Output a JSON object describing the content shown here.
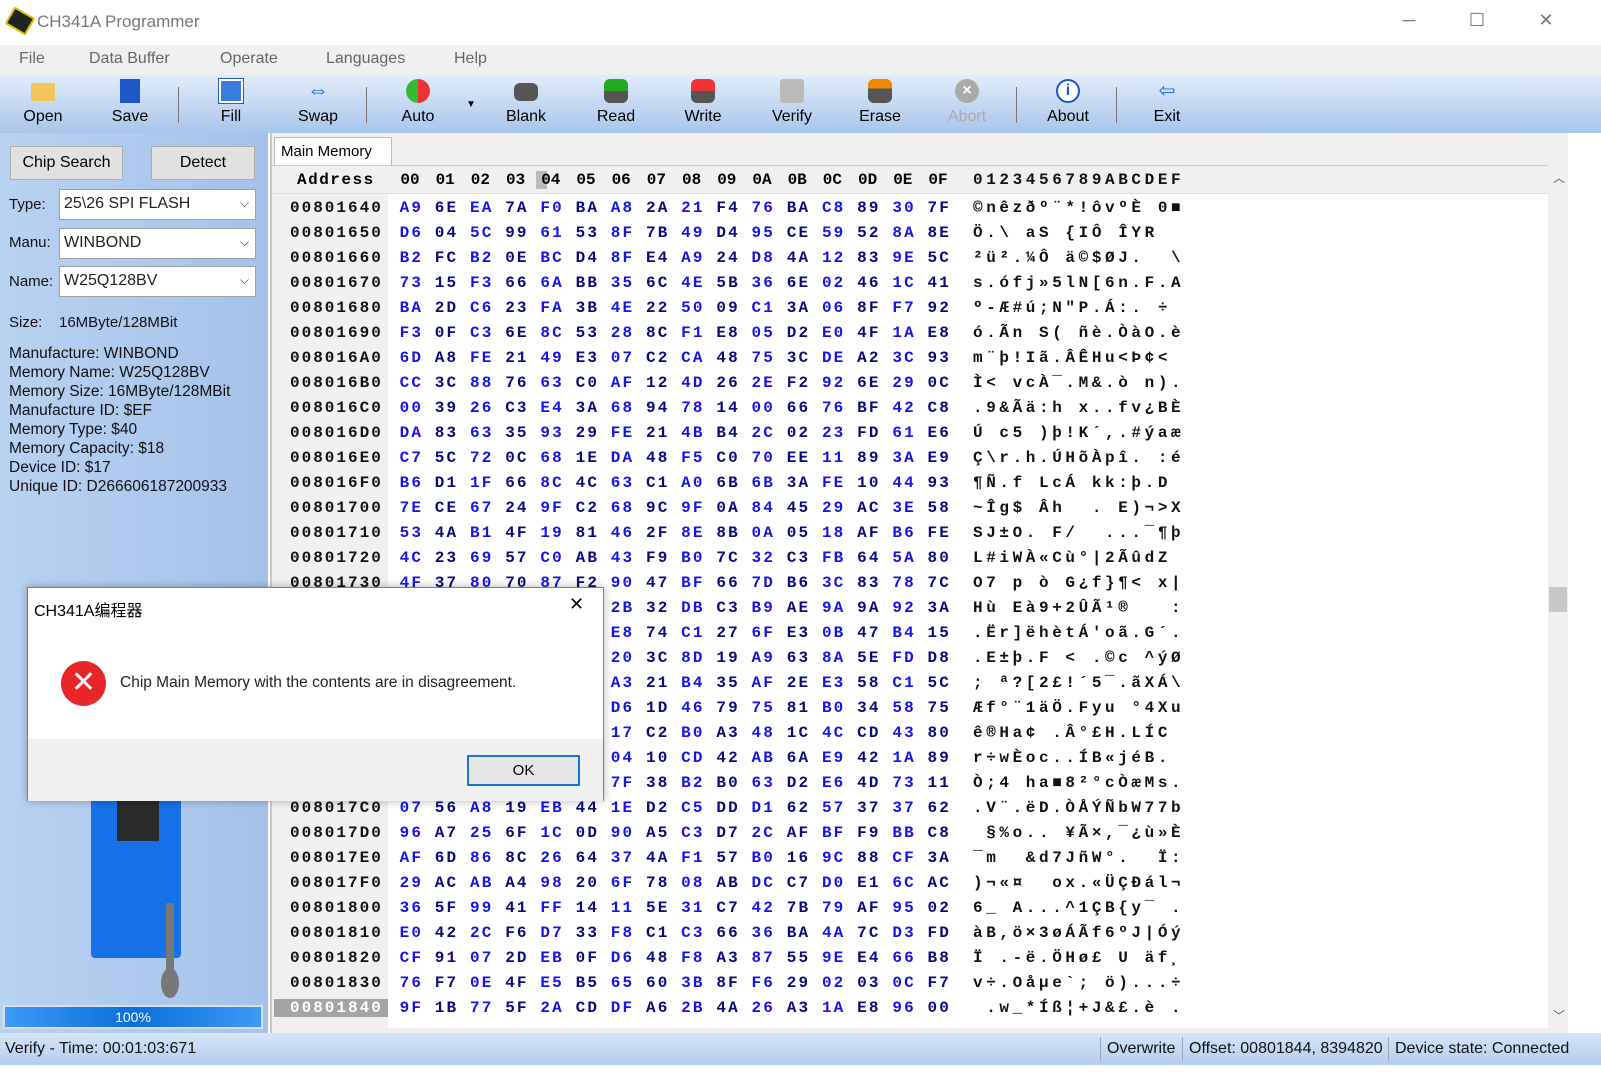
{
  "window": {
    "title": "CH341A Programmer",
    "min": "─",
    "max": "☐",
    "close": "✕"
  },
  "menu": [
    "File",
    "Data Buffer",
    "Operate",
    "Languages",
    "Help"
  ],
  "toolbar": {
    "open": "Open",
    "save": "Save",
    "fill": "Fill",
    "swap": "Swap",
    "auto": "Auto",
    "blank": "Blank",
    "read": "Read",
    "write": "Write",
    "verify": "Verify",
    "erase": "Erase",
    "abort": "Abort",
    "about": "About",
    "exit": "Exit",
    "dropdown": "▼"
  },
  "left": {
    "chip_search": "Chip Search",
    "detect": "Detect",
    "type_label": "Type:",
    "type_value": "25\\26 SPI FLASH",
    "manu_label": "Manu:",
    "manu_value": "WINBOND",
    "name_label": "Name:",
    "name_value": "W25Q128BV",
    "size_label": "Size:",
    "size_value": "16MByte/128MBit",
    "info": [
      "Manufacture: WINBOND",
      "Memory Name: W25Q128BV",
      "Memory Size: 16MByte/128MBit",
      "Manufacture ID: $EF",
      "Memory Type: $40",
      "Memory Capacity: $18",
      "Device ID: $17",
      "Unique ID: D266606187200933"
    ],
    "progress_percent": 100,
    "progress_label": "100%"
  },
  "tab": "Main Memory",
  "hexview": {
    "address_header": "Address",
    "col_headers": [
      "00",
      "01",
      "02",
      "03",
      "04",
      "05",
      "06",
      "07",
      "08",
      "09",
      "0A",
      "0B",
      "0C",
      "0D",
      "0E",
      "0F"
    ],
    "ascii_header": "0123456789ABCDEF",
    "selected_address": "00801840",
    "rows": [
      {
        "a": "00801640",
        "h": "A9 6E EA 7A F0 BA A8 2A 21 F4 76 BA C8 89 30 7F",
        "s": "©nêzðº¨*!ôvºÈ 0■"
      },
      {
        "a": "00801650",
        "h": "D6 04 5C 99 61 53 8F 7B 49 D4 95 CE 59 52 8A 8E",
        "s": "Ö.\\ aS {IÔ ÎYR  "
      },
      {
        "a": "00801660",
        "h": "B2 FC B2 0E BC D4 8F E4 A9 24 D8 4A 12 83 9E 5C",
        "s": "²ü².¼Ô ä©$ØJ.  \\"
      },
      {
        "a": "00801670",
        "h": "73 15 F3 66 6A BB 35 6C 4E 5B 36 6E 02 46 1C 41",
        "s": "s.ófj»5lN[6n.F.A"
      },
      {
        "a": "00801680",
        "h": "BA 2D C6 23 FA 3B 4E 22 50 09 C1 3A 06 8F F7 92",
        "s": "º-Æ#ú;N\"P.Á:. ÷ "
      },
      {
        "a": "00801690",
        "h": "F3 0F C3 6E 8C 53 28 8C F1 E8 05 D2 E0 4F 1A E8",
        "s": "ó.Ãn S( ñè.ÒàO.è"
      },
      {
        "a": "008016A0",
        "h": "6D A8 FE 21 49 E3 07 C2 CA 48 75 3C DE A2 3C 93",
        "s": "m¨þ!Iã.ÂÊHu<Þ¢< "
      },
      {
        "a": "008016B0",
        "h": "CC 3C 88 76 63 C0 AF 12 4D 26 2E F2 92 6E 29 0C",
        "s": "Ì< vcÀ¯.M&.ò n)."
      },
      {
        "a": "008016C0",
        "h": "00 39 26 C3 E4 3A 68 94 78 14 00 66 76 BF 42 C8",
        "s": ".9&Ãä:h x..fv¿BÈ"
      },
      {
        "a": "008016D0",
        "h": "DA 83 63 35 93 29 FE 21 4B B4 2C 02 23 FD 61 E6",
        "s": "Ú c5 )þ!K´,.#ýaæ"
      },
      {
        "a": "008016E0",
        "h": "C7 5C 72 0C 68 1E DA 48 F5 C0 70 EE 11 89 3A E9",
        "s": "Ç\\r.h.ÚHõÀpî. :é"
      },
      {
        "a": "008016F0",
        "h": "B6 D1 1F 66 8C 4C 63 C1 A0 6B 6B 3A FE 10 44 93",
        "s": "¶Ñ.f LcÁ kk:þ.D "
      },
      {
        "a": "00801700",
        "h": "7E CE 67 24 9F C2 68 9C 9F 0A 84 45 29 AC 3E 58",
        "s": "~Îg$ Âh  . E)¬>X"
      },
      {
        "a": "00801710",
        "h": "53 4A B1 4F 19 81 46 2F 8E 8B 0A 05 18 AF B6 FE",
        "s": "SJ±O. F/  ...¯¶þ"
      },
      {
        "a": "00801720",
        "h": "4C 23 69 57 C0 AB 43 F9 B0 7C 32 C3 FB 64 5A 80",
        "s": "L#iWÀ«Cù°|2ÃûdZ "
      },
      {
        "a": "00801730",
        "h": "4F 37 80 70 87 F2 90 47 BF 66 7D B6 3C 83 78 7C",
        "s": "O7 p ò G¿f}¶< x|"
      },
      {
        "a": "",
        "h": "- - - - - - 2B 32 DB C3 B9 AE 9A 9A 92 3A",
        "s": "Hù Eà9+2ÛÃ¹®   :"
      },
      {
        "a": "",
        "h": "- - - - - - E8 74 C1 27 6F E3 0B 47 B4 15",
        "s": ".Ër]ëhètÁ'oã.G´."
      },
      {
        "a": "",
        "h": "- - - - - - 20 3C 8D 19 A9 63 8A 5E FD D8",
        "s": ".E±þ.F < .©c ^ýØ"
      },
      {
        "a": "",
        "h": "- - - - - - A3 21 B4 35 AF 2E E3 58 C1 5C",
        "s": "; ª?[2£!´5¯.ãXÁ\\"
      },
      {
        "a": "",
        "h": "- - - - - - D6 1D 46 79 75 81 B0 34 58 75",
        "s": "Æf°¨1äÖ.Fyu °4Xu"
      },
      {
        "a": "",
        "h": "- - - - - - 17 C2 B0 A3 48 1C 4C CD 43 80",
        "s": "ê®Ha¢ .Â°£H.LÍC "
      },
      {
        "a": "",
        "h": "- - - - - - 04 10 CD 42 AB 6A E9 42 1A 89",
        "s": "r÷wÈoc..ÍB«jéB. "
      },
      {
        "a": "",
        "h": "- - - - - - 7F 38 B2 B0 63 D2 E6 4D 73 11",
        "s": "Ò;4 ha■8²°cÒæMs."
      },
      {
        "a": "008017C0",
        "h": "07 56 A8 19 EB 44 1E D2 C5 DD D1 62 57 37 37 62",
        "s": ".V¨.ëD.ÒÅÝÑbW77b"
      },
      {
        "a": "008017D0",
        "h": "96 A7 25 6F 1C 0D 90 A5 C3 D7 2C AF BF F9 BB C8",
        "s": " §%o.. ¥Ã×,¯¿ù»È"
      },
      {
        "a": "008017E0",
        "h": "AF 6D 86 8C 26 64 37 4A F1 57 B0 16 9C 88 CF 3A",
        "s": "¯m  &d7JñW°.  Ï:"
      },
      {
        "a": "008017F0",
        "h": "29 AC AB A4 98 20 6F 78 08 AB DC C7 D0 E1 6C AC",
        "s": ")¬«¤  ox.«ÜÇÐál¬"
      },
      {
        "a": "00801800",
        "h": "36 5F 99 41 FF 14 11 5E 31 C7 42 7B 79 AF 95 02",
        "s": "6_ A...^1ÇB{y¯ ."
      },
      {
        "a": "00801810",
        "h": "E0 42 2C F6 D7 33 F8 C1 C3 66 36 BA 4A 7C D3 FD",
        "s": "àB,ö×3øÁÃf6ºJ|Óý"
      },
      {
        "a": "00801820",
        "h": "CF 91 07 2D EB 0F D6 48 F8 A3 87 55 9E E4 66 B8",
        "s": "Ï .-ë.ÖHø£ U äf¸"
      },
      {
        "a": "00801830",
        "h": "76 F7 0E 4F E5 B5 65 60 3B 8F F6 29 02 03 0C F7",
        "s": "v÷.Oåµe`; ö)...÷"
      },
      {
        "a": "00801840",
        "h": "9F 1B 77 5F 2A CD DF A6 2B 4A 26 A3 1A E8 96 00",
        "s": " .w_*Íß¦+J&£.è ."
      }
    ]
  },
  "status": {
    "left": "Verify - Time: 00:01:03:671",
    "mode": "Overwrite",
    "offset": "Offset: 00801844, 8394820",
    "device": "Device state: Connected"
  },
  "dialog": {
    "title": "CH341A编程器",
    "message": "Chip Main Memory with the contents are in disagreement.",
    "ok": "OK",
    "close": "✕"
  },
  "colors": {
    "accent": "#1a73d8",
    "hex_even": "#1414e6",
    "hex_odd": "#0a0a78",
    "error": "#e8262a"
  }
}
